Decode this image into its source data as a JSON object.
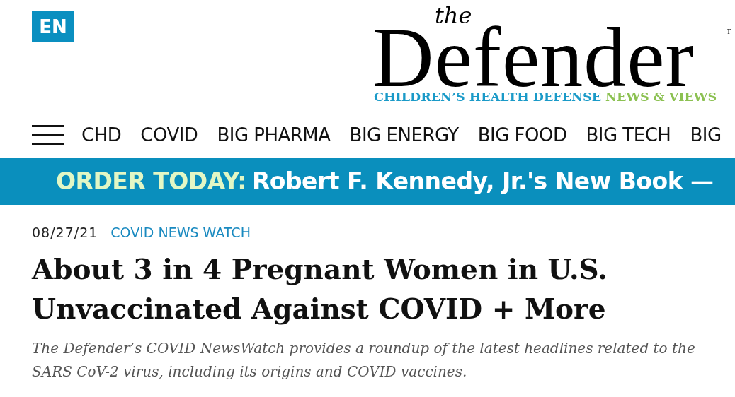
{
  "language_badge": "EN",
  "logo": {
    "the": "the",
    "name": "Defender",
    "trademark": "T",
    "tagline_main": "CHILDREN’S HEALTH DEFENSE",
    "tagline_accent": "NEWS & VIEWS"
  },
  "nav": {
    "items": [
      "CHD",
      "COVID",
      "BIG PHARMA",
      "BIG ENERGY",
      "BIG FOOD",
      "BIG TECH",
      "BIG"
    ]
  },
  "banner": {
    "highlight": "ORDER TODAY:",
    "text": "Robert F. Kennedy, Jr.'s New Book —"
  },
  "article": {
    "date": "08/27/21",
    "category": "COVID NEWS WATCH",
    "headline": "About 3 in 4 Pregnant Women in U.S. Unvaccinated Against COVID + More",
    "summary": "The Defender’s COVID NewsWatch provides a roundup of the latest headlines related to the SARS CoV-2 virus, including its origins and COVID vaccines."
  }
}
